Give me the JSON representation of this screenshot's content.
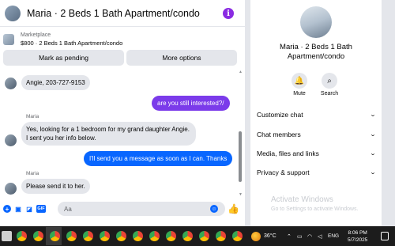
{
  "header": {
    "title": "Maria · 2 Beds 1 Bath Apartment/condo",
    "info_glyph": "i"
  },
  "listing": {
    "label": "Marketplace",
    "summary": "$800 · 2 Beds 1 Bath Apartment/condo"
  },
  "actions": {
    "pending_label": "Mark as pending",
    "more_label": "More options"
  },
  "messages": [
    {
      "from": "them",
      "sender": "",
      "text": "Angie, 203-727-9153"
    },
    {
      "from": "me",
      "text": "are you still interested?/",
      "color": "#7b3bea"
    },
    {
      "from": "them",
      "sender": "Maria",
      "text": "Yes, looking for a 1 bedroom for my grand daughter Angie. I sent you her info below."
    },
    {
      "from": "me",
      "text": "I'll send you a message as soon as I can. Thanks",
      "color": "#0866ff"
    },
    {
      "from": "them",
      "sender": "Maria",
      "text": "Please send it to her."
    }
  ],
  "composer": {
    "placeholder": "Aa",
    "gif_label": "GIF",
    "icons": [
      "plus-icon",
      "image-icon",
      "sticker-icon",
      "gif-icon",
      "emoji-icon",
      "like-icon"
    ]
  },
  "info_panel": {
    "name": "Maria · 2 Beds 1 Bath Apartment/condo",
    "mute_label": "Mute",
    "search_label": "Search",
    "sections": [
      "Customize chat",
      "Chat members",
      "Media, files and links",
      "Privacy & support"
    ]
  },
  "watermark": {
    "title": "Activate Windows",
    "subtitle": "Go to Settings to activate Windows."
  },
  "taskbar": {
    "temperature": "36°C",
    "language": "ENG",
    "time": "8:06 PM",
    "date": "5/7/2025"
  },
  "colors": {
    "accent": "#0866ff",
    "purple": "#7b3bea",
    "bubble_in": "#e4e6eb"
  }
}
